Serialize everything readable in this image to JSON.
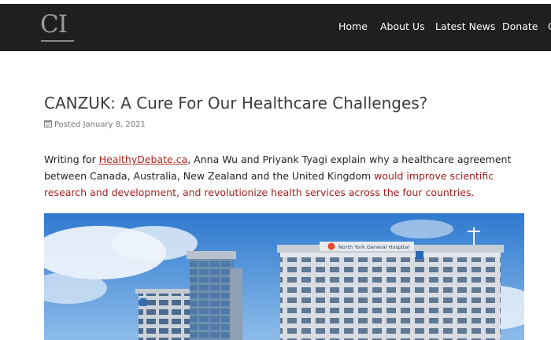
{
  "header": {
    "logo_text": "CI",
    "nav": [
      {
        "label": "Home"
      },
      {
        "label": "About Us"
      },
      {
        "label": "Latest News"
      },
      {
        "label": "Donate"
      },
      {
        "label": "C"
      }
    ]
  },
  "article": {
    "title": "CANZUK: A Cure For Our Healthcare Challenges?",
    "posted": "Posted January 8, 2021",
    "intro_prefix": "Writing for ",
    "link_text": "HealthyDebate.ca",
    "intro_mid": ", Anna Wu and Priyank Tyagi explain why a healthcare agreement between Canada, Australia, New Zealand and the United Kingdom ",
    "highlight": "would improve scientific research and development, and revolutionize health services across the four countries.",
    "image_sign": "North York General Hospital"
  },
  "colors": {
    "nav_background": "#1f1f1f",
    "accent_red": "#a11d1d",
    "sky": "#3f8ad9"
  }
}
